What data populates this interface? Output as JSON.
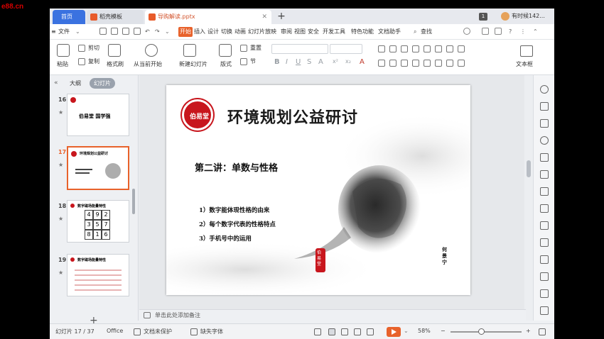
{
  "watermark": "e88.cn",
  "tabs": {
    "home": "首页",
    "template": "稻壳模板",
    "document": "导购解读.pptx",
    "badge": "1",
    "user": "有时候142..."
  },
  "menu": {
    "file": "文件",
    "items": [
      "开始",
      "插入",
      "设计",
      "切换",
      "动画",
      "幻灯片放映",
      "审阅",
      "视图",
      "安全",
      "开发工具",
      "特色功能",
      "文档助手"
    ],
    "search": "查找",
    "active_color": "#e8622b"
  },
  "ribbon": {
    "paste": "粘贴",
    "cut": "剪切",
    "copy": "复制",
    "format_painter": "格式刷",
    "from_current": "从当前开始",
    "new_slide": "新建幻灯片",
    "layout": "版式",
    "section": "节",
    "reset": "重置",
    "textbox": "文本框",
    "format_buttons": [
      "B",
      "I",
      "U",
      "S",
      "A",
      "x²",
      "x₂",
      "A"
    ]
  },
  "panel": {
    "outline_tab": "大纲",
    "slides_tab": "幻灯片",
    "thumbnails": [
      {
        "num": "16",
        "text": "伯易堂 国学强"
      },
      {
        "num": "17",
        "text": "环境规划公益研讨"
      },
      {
        "num": "18",
        "text": "数字磁场能量特性"
      },
      {
        "num": "19",
        "text": "数字磁场能量特性"
      }
    ],
    "magic_square": [
      "4",
      "9",
      "2",
      "3",
      "5",
      "7",
      "8",
      "1",
      "6"
    ],
    "add": "+"
  },
  "slide": {
    "logo_text": "伯易堂",
    "title": "环境规划公益研讨",
    "subtitle": "第二讲：单数与性格",
    "bullets": [
      "1）数字能体现性格的由来",
      "2）每个数字代表的性格特点",
      "3）手机号中的运用"
    ],
    "seal_text": "伯易堂",
    "author": "何景宁"
  },
  "notes": {
    "placeholder": "单击此处添加备注"
  },
  "status": {
    "slide_count": "幻灯片 17 / 37",
    "theme": "Office",
    "protect": "文档未保护",
    "missing_font": "缺失字体",
    "zoom": "58%",
    "zoom_fraction": 0.58,
    "minus": "−",
    "plus": "+"
  }
}
